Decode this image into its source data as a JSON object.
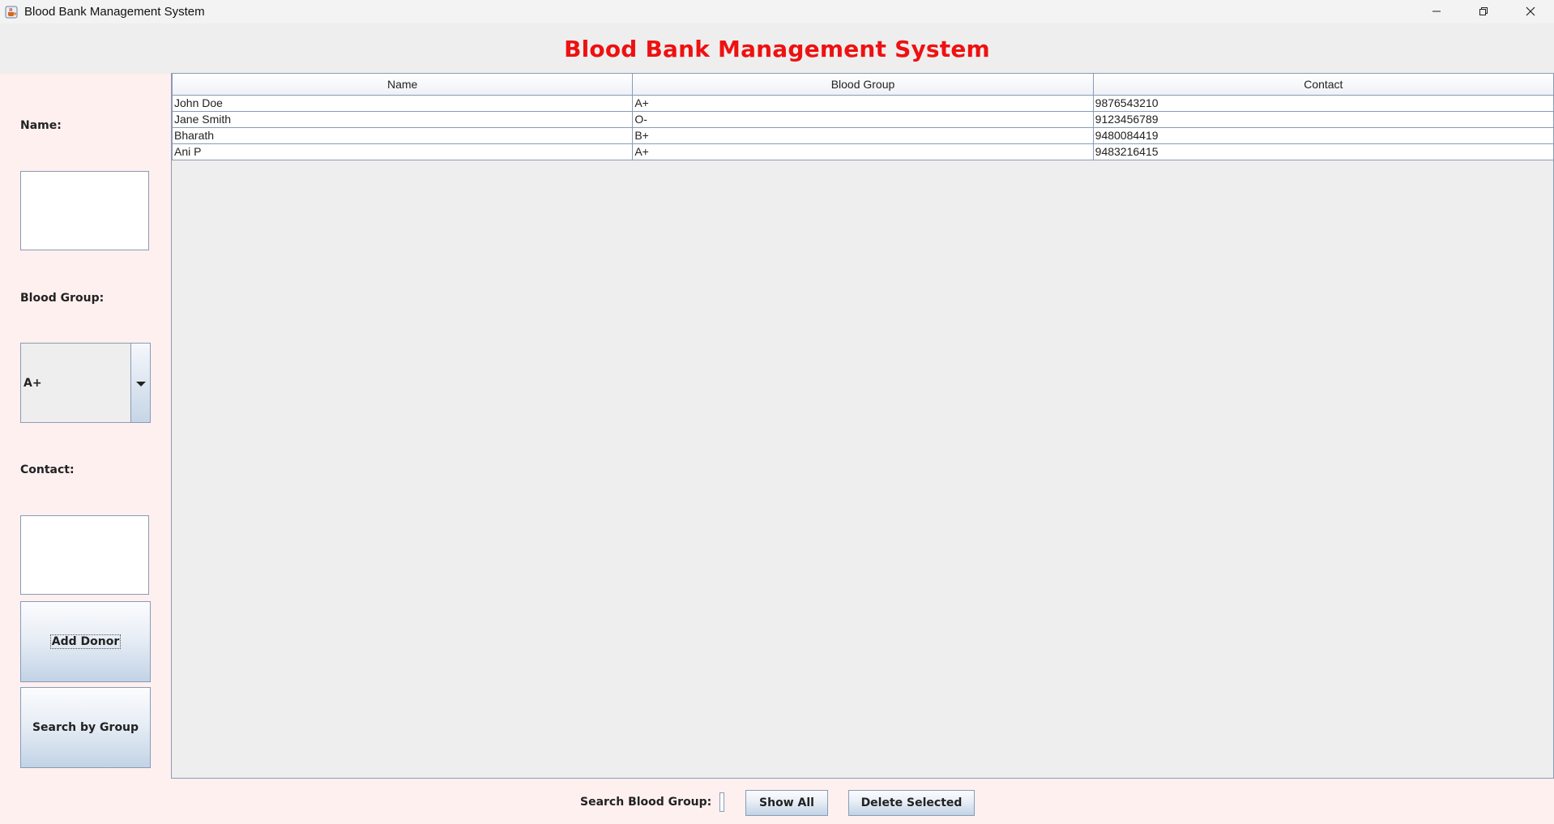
{
  "window": {
    "title": "Blood Bank Management System"
  },
  "header": {
    "title": "Blood Bank Management System",
    "title_color": "#ee1111"
  },
  "form": {
    "name_label": "Name:",
    "name_value": "",
    "blood_group_label": "Blood Group:",
    "blood_group_selected": "A+",
    "contact_label": "Contact:",
    "contact_value": "",
    "add_donor_label": "Add Donor",
    "search_by_group_label": "Search by Group"
  },
  "table": {
    "columns": [
      "Name",
      "Blood Group",
      "Contact"
    ],
    "rows": [
      [
        "John Doe",
        "A+",
        "9876543210"
      ],
      [
        "Jane Smith",
        "O-",
        "9123456789"
      ],
      [
        "Bharath",
        "B+",
        "9480084419"
      ],
      [
        "Ani P",
        "A+",
        "9483216415"
      ]
    ]
  },
  "bottom": {
    "search_label": "Search Blood Group:",
    "search_value": "",
    "show_all_label": "Show All",
    "delete_selected_label": "Delete Selected"
  },
  "icons": {
    "app": "java-cup-icon",
    "minimize": "minimize-icon",
    "maximize": "restore-icon",
    "close": "close-icon",
    "dropdown": "triangle-down-icon"
  }
}
